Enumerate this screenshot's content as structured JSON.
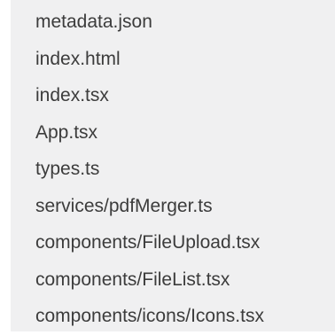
{
  "files": [
    "metadata.json",
    "index.html",
    "index.tsx",
    "App.tsx",
    "types.ts",
    "services/pdfMerger.ts",
    "components/FileUpload.tsx",
    "components/FileList.tsx",
    "components/icons/Icons.tsx"
  ]
}
